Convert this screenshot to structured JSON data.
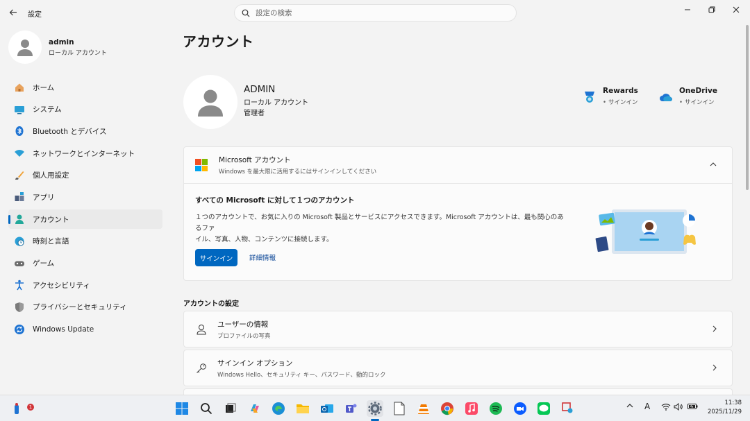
{
  "titlebar": {
    "app_title": "設定",
    "search_placeholder": "設定の検索"
  },
  "profile": {
    "name": "admin",
    "type": "ローカル アカウント"
  },
  "nav": [
    {
      "label": "ホーム",
      "icon": "home-icon"
    },
    {
      "label": "システム",
      "icon": "system-icon"
    },
    {
      "label": "Bluetooth とデバイス",
      "icon": "bluetooth-icon"
    },
    {
      "label": "ネットワークとインターネット",
      "icon": "wifi-icon"
    },
    {
      "label": "個人用設定",
      "icon": "brush-icon"
    },
    {
      "label": "アプリ",
      "icon": "apps-icon"
    },
    {
      "label": "アカウント",
      "icon": "account-icon",
      "active": true
    },
    {
      "label": "時刻と言語",
      "icon": "globe-clock-icon"
    },
    {
      "label": "ゲーム",
      "icon": "gamepad-icon"
    },
    {
      "label": "アクセシビリティ",
      "icon": "accessibility-icon"
    },
    {
      "label": "プライバシーとセキュリティ",
      "icon": "shield-icon"
    },
    {
      "label": "Windows Update",
      "icon": "update-icon"
    }
  ],
  "main": {
    "page_title": "アカウント",
    "account": {
      "name": "ADMIN",
      "type": "ローカル アカウント",
      "role": "管理者"
    },
    "services": [
      {
        "name": "Rewards",
        "status": "サインイン",
        "icon": "rewards-icon"
      },
      {
        "name": "OneDrive",
        "status": "サインイン",
        "icon": "onedrive-icon"
      }
    ],
    "ms_card": {
      "title": "Microsoft アカウント",
      "subtitle": "Windows を最大限に活用するにはサインインしてください",
      "body_title": "すべての Microsoft に対して１つのアカウント",
      "body_text_1": "１つのアカウントで、お気に入りの Microsoft 製品とサービスにアクセスできます。Microsoft アカウントは、最も関心のあるファ",
      "body_text_2": "イル、写真、人物、コンテンツに接続します。",
      "signin_button": "サインイン",
      "details_link": "詳細情報"
    },
    "section_title": "アカウントの設定",
    "settings_rows": [
      {
        "title": "ユーザーの情報",
        "subtitle": "プロファイルの写真",
        "icon": "person-icon"
      },
      {
        "title": "サインイン オプション",
        "subtitle": "Windows Hello、セキュリティ キー、パスワード、動的ロック",
        "icon": "key-icon"
      }
    ]
  },
  "taskbar": {
    "notification_count": "1",
    "time": "11:38",
    "date": "2025/11/29",
    "ime": "A"
  },
  "colors": {
    "accent": "#0067c0",
    "link": "#003e92"
  }
}
